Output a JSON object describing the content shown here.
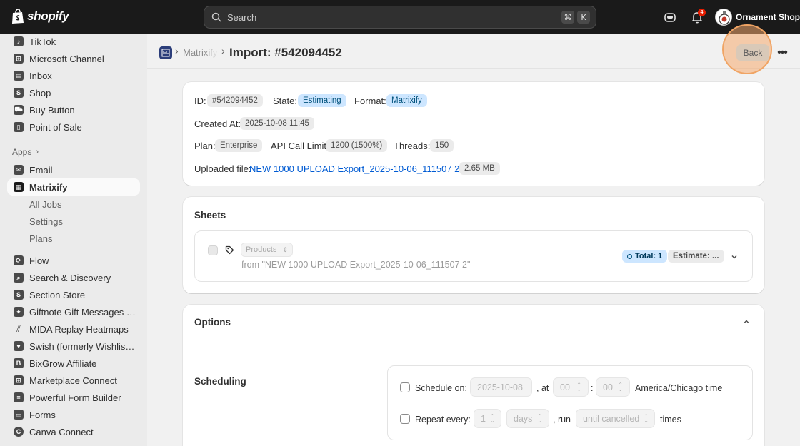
{
  "topbar": {
    "logo_text": "shopify",
    "search_placeholder": "Search",
    "shortcut_keys": [
      "⌘",
      "K"
    ],
    "notification_count": "4",
    "store_name": "Ornament Shop"
  },
  "sidebar": {
    "channels": [
      {
        "label": "TikTok",
        "icon": "tiktok-icon"
      },
      {
        "label": "Microsoft Channel",
        "icon": "microsoft-icon"
      },
      {
        "label": "Inbox",
        "icon": "inbox-icon"
      },
      {
        "label": "Shop",
        "icon": "shop-icon"
      },
      {
        "label": "Buy Button",
        "icon": "buy-button-icon"
      },
      {
        "label": "Point of Sale",
        "icon": "point-of-sale-icon"
      }
    ],
    "apps_heading": "Apps",
    "apps": [
      {
        "label": "Email",
        "icon": "email-icon"
      },
      {
        "label": "Matrixify",
        "icon": "matrixify-icon",
        "active": true
      }
    ],
    "matrixify_sub": [
      "All Jobs",
      "Settings",
      "Plans"
    ],
    "more_apps": [
      {
        "label": "Flow",
        "icon": "flow-icon"
      },
      {
        "label": "Search & Discovery",
        "icon": "search-discovery-icon"
      },
      {
        "label": "Section Store",
        "icon": "section-store-icon"
      },
      {
        "label": "Giftnote Gift Messages & ...",
        "icon": "giftnote-icon"
      },
      {
        "label": "MIDA Replay Heatmaps",
        "icon": "mida-icon"
      },
      {
        "label": "Swish (formerly Wishlist ...",
        "icon": "swish-icon"
      },
      {
        "label": "BixGrow Affiliate",
        "icon": "bixgrow-icon"
      },
      {
        "label": "Marketplace Connect",
        "icon": "marketplace-icon"
      },
      {
        "label": "Powerful Form Builder",
        "icon": "form-builder-icon"
      },
      {
        "label": "Forms",
        "icon": "forms-icon"
      },
      {
        "label": "Canva Connect",
        "icon": "canva-icon"
      }
    ]
  },
  "header": {
    "breadcrumb_app": "Matrixify",
    "title": "Import: #542094452",
    "back_label": "Back"
  },
  "details": {
    "id_label": "ID:",
    "id_value": "#542094452",
    "state_label": "State:",
    "state_value": "Estimating",
    "format_label": "Format:",
    "format_value": "Matrixify",
    "created_label": "Created At:",
    "created_value": "2025-10-08 11:45",
    "plan_label": "Plan:",
    "plan_value": "Enterprise",
    "api_label": "API Call Limit:",
    "api_value": "1200 (1500%)",
    "threads_label": "Threads:",
    "threads_value": "150",
    "uploaded_label": "Uploaded file:",
    "uploaded_file": "NEW 1000 UPLOAD Export_2025-10-06_111507 2.csv",
    "file_size": "2.65 MB"
  },
  "sheets": {
    "title": "Sheets",
    "sheet_type": "Products",
    "sheet_source": "from \"NEW 1000 UPLOAD Export_2025-10-06_111507 2\"",
    "total_badge": "Total: 1",
    "estimate_badge": "Estimate: ..."
  },
  "options": {
    "title": "Options",
    "scheduling_title": "Scheduling",
    "schedule_on_label": "Schedule on:",
    "schedule_date": "2025-10-08",
    "at_label": ", at",
    "hour": "00",
    "colon": ":",
    "minute": "00",
    "timezone": "America/Chicago time",
    "repeat_label": "Repeat every:",
    "repeat_count": "1",
    "repeat_unit": "days",
    "run_label": ", run",
    "run_value": "until cancelled",
    "times_label": "times"
  }
}
